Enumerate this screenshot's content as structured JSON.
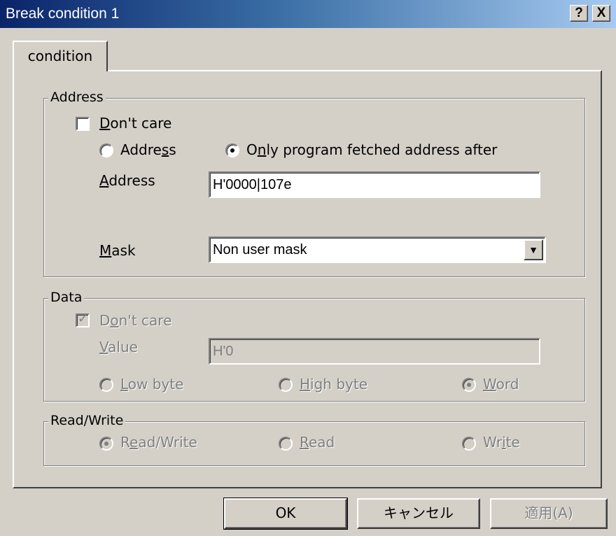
{
  "window": {
    "title": "Break condition 1",
    "help_btn": "?",
    "close_btn": "X"
  },
  "tabs": [
    {
      "label": "condition"
    }
  ],
  "address_group": {
    "legend": "Address",
    "dont_care": {
      "label": "Don't care",
      "checked": false
    },
    "radio_address": {
      "label": "Address",
      "selected": false
    },
    "radio_fetched": {
      "label": "Only program fetched address after",
      "selected": true
    },
    "address_label": "Address",
    "address_value": "H'0000|107e",
    "mask_label": "Mask",
    "mask_value": "Non user mask"
  },
  "data_group": {
    "legend": "Data",
    "dont_care": {
      "label": "Don't care",
      "checked": true
    },
    "value_label": "Value",
    "value": "H'0",
    "radio_low": {
      "label": "Low byte",
      "selected": false
    },
    "radio_high": {
      "label": "High byte",
      "selected": false
    },
    "radio_word": {
      "label": "Word",
      "selected": true
    }
  },
  "rw_group": {
    "legend": "Read/Write",
    "radio_rw": {
      "label": "Read/Write",
      "selected": true
    },
    "radio_read": {
      "label": "Read",
      "selected": false
    },
    "radio_write": {
      "label": "Write",
      "selected": false
    }
  },
  "buttons": {
    "ok": "OK",
    "cancel": "キャンセル",
    "apply": "適用(A)"
  }
}
